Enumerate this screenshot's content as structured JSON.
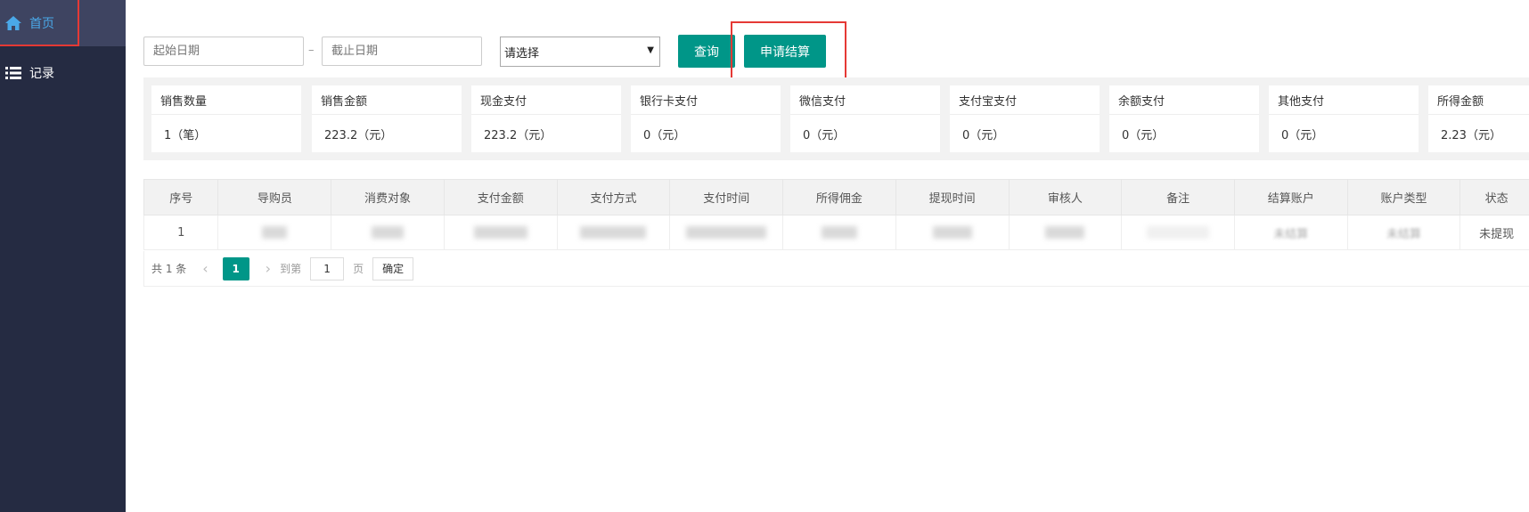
{
  "sidebar": {
    "items": [
      {
        "label": "首页",
        "icon": "home-icon"
      },
      {
        "label": "记录",
        "icon": "list-icon"
      }
    ]
  },
  "filters": {
    "start_placeholder": "起始日期",
    "separator": "–",
    "end_placeholder": "截止日期",
    "select_value": "请选择",
    "select_arrow": "▼",
    "query_label": "查询",
    "apply_label": "申请结算"
  },
  "stats": [
    {
      "title": "销售数量",
      "value": "1（笔）"
    },
    {
      "title": "销售金额",
      "value": "223.2（元）"
    },
    {
      "title": "现金支付",
      "value": "223.2（元）"
    },
    {
      "title": "银行卡支付",
      "value": "0（元）"
    },
    {
      "title": "微信支付",
      "value": "0（元）"
    },
    {
      "title": "支付宝支付",
      "value": "0（元）"
    },
    {
      "title": "余额支付",
      "value": "0（元）"
    },
    {
      "title": "其他支付",
      "value": "0（元）"
    },
    {
      "title": "所得金额",
      "value": "2.23（元）"
    }
  ],
  "table": {
    "headers": [
      "序号",
      "导购员",
      "消费对象",
      "支付金额",
      "支付方式",
      "支付时间",
      "所得佣金",
      "提现时间",
      "审核人",
      "备注",
      "结算账户",
      "账户类型",
      "状态"
    ],
    "rows": [
      {
        "index": "1",
        "account": "未结算",
        "account_type": "未结算",
        "status": "未提现"
      }
    ]
  },
  "pager": {
    "total": "共 1 条",
    "prev": "‹",
    "current": "1",
    "next": "›",
    "goto_label": "到第",
    "goto_value": "1",
    "page_label": "页",
    "confirm_label": "确定"
  },
  "colors": {
    "accent": "#009688",
    "sidebar_bg": "#252b42",
    "highlight": "#e53935"
  }
}
